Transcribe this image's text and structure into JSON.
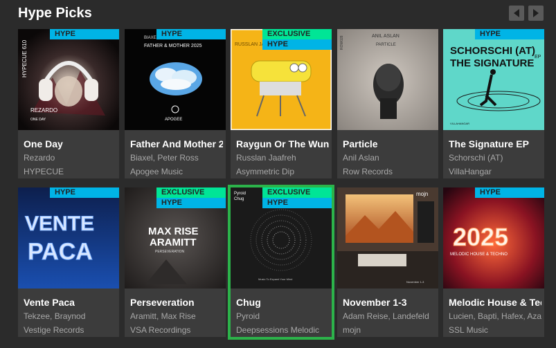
{
  "section": {
    "title": "Hype Picks"
  },
  "badges": {
    "hype": "HYPE",
    "exclusive": "EXCLUSIVE"
  },
  "releases": [
    {
      "title": "One Day",
      "artists": "Rezardo",
      "label": "HYPECUE",
      "hype": true,
      "exclusive": false,
      "cover_text": {
        "main": "REZARDO",
        "sub": "ONE DAY",
        "side": "HYPECUE 610"
      }
    },
    {
      "title": "Father And Mother 2",
      "artists": "Biaxel, Peter Ross",
      "label": "Apogee Music",
      "hype": true,
      "exclusive": false,
      "cover_text": {
        "main": "APOGEE",
        "top": "BIAXEL & PETER ROSS",
        "sub": "FATHER & MOTHER 2025"
      }
    },
    {
      "title": "Raygun Or The Wune",
      "artists": "Russlan Jaafreh",
      "label": "Asymmetric Dip",
      "hype": true,
      "exclusive": true,
      "cover_text": {
        "main": "RUSSLAN JAAFREH"
      }
    },
    {
      "title": "Particle",
      "artists": "Anil Aslan",
      "label": "Row Records",
      "hype": false,
      "exclusive": false,
      "cover_text": {
        "main": "ANIL ASLAN",
        "sub": "PARTICLE",
        "side": "ROW028"
      }
    },
    {
      "title": "The Signature EP",
      "artists": "Schorschi (AT)",
      "label": "VillaHangar",
      "hype": true,
      "exclusive": false,
      "cover_text": {
        "main": "SCHORSCHI (AT)",
        "sub": "THE SIGNATURE",
        "ep": "EP",
        "small": "VILLAHANGAR"
      }
    },
    {
      "title": "Vente Paca",
      "artists": "Tekzee, Braynod",
      "label": "Vestige Records",
      "hype": true,
      "exclusive": false,
      "cover_text": {
        "main": "VENTE",
        "sub": "PACA"
      }
    },
    {
      "title": "Perseveration",
      "artists": "Aramitt, Max Rise",
      "label": "VSA Recordings",
      "hype": true,
      "exclusive": true,
      "cover_text": {
        "main": "MAX RISE",
        "sub": "ARAMITT",
        "small": "PERSEVERATION"
      }
    },
    {
      "title": "Chug",
      "artists": "Pyroid",
      "label": "Deepsessions Melodic",
      "hype": true,
      "exclusive": true,
      "cover_text": {
        "main": "Pyroid",
        "sub": "Chug",
        "small": "Music To Expand Your Mind"
      }
    },
    {
      "title": "November 1-3",
      "artists": "Adam Reise, Landefeld",
      "label": "mojn",
      "hype": false,
      "exclusive": false,
      "cover_text": {
        "main": "mojn",
        "sub": "November 1-3"
      }
    },
    {
      "title": "Melodic House & Techno",
      "artists": "Lucien, Bapti, Hafex, Aza",
      "label": "SSL Music",
      "hype": true,
      "exclusive": false,
      "cover_text": {
        "main": "2025",
        "sub": "MELODIC HOUSE & TECHNO"
      }
    }
  ],
  "selected_index": 7
}
